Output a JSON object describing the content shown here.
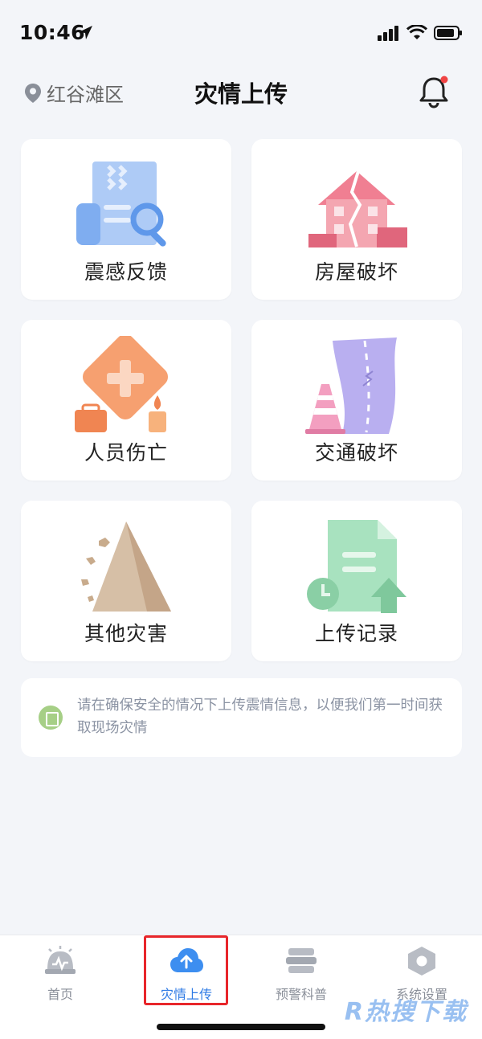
{
  "status_bar": {
    "time": "10:46"
  },
  "header": {
    "location": "红谷滩区",
    "title": "灾情上传"
  },
  "cards": [
    {
      "label": "震感反馈",
      "icon": "document-search-icon",
      "color": "#8fb7f2"
    },
    {
      "label": "房屋破坏",
      "icon": "cracked-building-icon",
      "color": "#ef8f9c"
    },
    {
      "label": "人员伤亡",
      "icon": "medical-cross-icon",
      "color": "#f39a6a"
    },
    {
      "label": "交通破坏",
      "icon": "damaged-road-icon",
      "color": "#b3a9e4"
    },
    {
      "label": "其他灾害",
      "icon": "landslide-icon",
      "color": "#c8ab8c"
    },
    {
      "label": "上传记录",
      "icon": "upload-record-icon",
      "color": "#8fd3a8"
    }
  ],
  "notice": {
    "text": "请在确保安全的情况下上传震情信息，以便我们第一时间获取现场灾情"
  },
  "tabs": [
    {
      "label": "首页",
      "icon": "alarm-icon",
      "active": false
    },
    {
      "label": "灾情上传",
      "icon": "cloud-upload-icon",
      "active": true
    },
    {
      "label": "预警科普",
      "icon": "books-icon",
      "active": false
    },
    {
      "label": "系统设置",
      "icon": "settings-hexagon-icon",
      "active": false
    }
  ],
  "watermark": "R热搜下载",
  "colors": {
    "accent": "#2f7be5",
    "highlight_border": "#e8262b",
    "background": "#f3f5f9"
  }
}
